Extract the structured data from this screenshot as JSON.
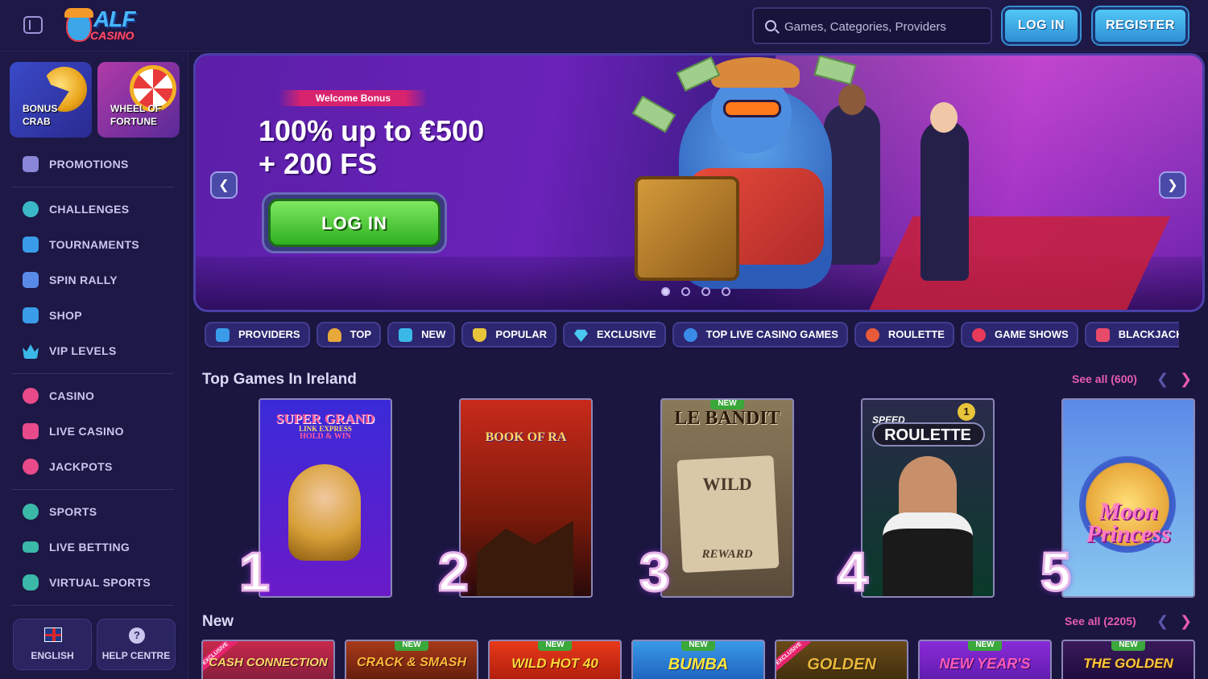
{
  "header": {
    "logo_line1": "ALF",
    "logo_line2": "CASINO",
    "search_placeholder": "Games, Categories, Providers",
    "login_label": "LOG IN",
    "register_label": "REGISTER"
  },
  "sidebar": {
    "promo_tiles": [
      {
        "label_line1": "BONUS",
        "label_line2": "CRAB"
      },
      {
        "label_line1": "WHEEL OF",
        "label_line2": "FORTUNE"
      }
    ],
    "items": [
      {
        "label": "PROMOTIONS",
        "icon": "gift-icon"
      },
      {
        "label": "CHALLENGES",
        "icon": "medal-icon"
      },
      {
        "label": "TOURNAMENTS",
        "icon": "podium-icon"
      },
      {
        "label": "SPIN RALLY",
        "icon": "flag-icon"
      },
      {
        "label": "SHOP",
        "icon": "shopping-bag-icon"
      },
      {
        "label": "VIP LEVELS",
        "icon": "crown-icon"
      },
      {
        "label": "CASINO",
        "icon": "cherry-icon"
      },
      {
        "label": "LIVE CASINO",
        "icon": "cards-icon"
      },
      {
        "label": "JACKPOTS",
        "icon": "clover-icon"
      },
      {
        "label": "SPORTS",
        "icon": "ball-icon"
      },
      {
        "label": "LIVE BETTING",
        "icon": "live-icon"
      },
      {
        "label": "VIRTUAL SPORTS",
        "icon": "gamepad-icon"
      }
    ],
    "language_label": "ENGLISH",
    "help_label": "HELP CENTRE",
    "help_glyph": "?"
  },
  "banner": {
    "tag": "Welcome Bonus",
    "headline_line1": "100% up to €500",
    "headline_line2": "+ 200 FS",
    "cta_label": "LOG IN",
    "prev_glyph": "❮",
    "next_glyph": "❯",
    "slide_count": 4,
    "active_slide": 1
  },
  "categories": [
    {
      "label": "PROVIDERS",
      "icon": "providers-icon",
      "color": "#3a9be8"
    },
    {
      "label": "TOP",
      "icon": "trophy-icon",
      "color": "#e8a83a"
    },
    {
      "label": "NEW",
      "icon": "sparkle-icon",
      "color": "#3ab8e8"
    },
    {
      "label": "POPULAR",
      "icon": "shield-icon",
      "color": "#e8c43a"
    },
    {
      "label": "EXCLUSIVE",
      "icon": "diamond-icon",
      "color": "#4ac8f0"
    },
    {
      "label": "TOP LIVE CASINO GAMES",
      "icon": "globe-icon",
      "color": "#3a8ae8"
    },
    {
      "label": "ROULETTE",
      "icon": "roulette-icon",
      "color": "#e85a3a"
    },
    {
      "label": "GAME SHOWS",
      "icon": "wheel-icon",
      "color": "#e83a5a"
    },
    {
      "label": "BLACKJACK",
      "icon": "cards-icon",
      "color": "#e84a6a"
    }
  ],
  "top_games": {
    "title": "Top Games In Ireland",
    "see_all": "See all (600)",
    "prev_glyph": "❮",
    "next_glyph": "❯",
    "games": [
      {
        "rank": "1",
        "title_line1": "SUPER GRAND",
        "title_line2": "LINK EXPRESS",
        "title_line3": "HOLD & WIN",
        "new": ""
      },
      {
        "rank": "2",
        "title_line1": "BOOK OF RA",
        "title_line2": "",
        "title_line3": "",
        "new": ""
      },
      {
        "rank": "3",
        "title_line1": "LE BANDIT",
        "title_line2": "WILD",
        "title_line3": "REWARD",
        "new": "NEW"
      },
      {
        "rank": "4",
        "title_line1": "SPEED",
        "title_line2": "ROULETTE",
        "title_line3": "1",
        "new": ""
      },
      {
        "rank": "5",
        "title_line1": "Moon",
        "title_line2": "Princess",
        "title_line3": "",
        "new": ""
      }
    ]
  },
  "new_games": {
    "title": "New",
    "see_all": "See all (2205)",
    "prev_glyph": "❮",
    "next_glyph": "❯",
    "games": [
      {
        "title": "CASH CONNECTION",
        "badge": "",
        "exclusive": "EXCLUSIVE"
      },
      {
        "title": "CRACK & SMASH",
        "badge": "NEW",
        "exclusive": ""
      },
      {
        "title": "WILD HOT 40",
        "badge": "NEW",
        "exclusive": ""
      },
      {
        "title": "BUMBA",
        "badge": "NEW",
        "exclusive": ""
      },
      {
        "title": "GOLDEN",
        "badge": "",
        "exclusive": "EXCLUSIVE"
      },
      {
        "title": "NEW YEAR'S",
        "badge": "NEW",
        "exclusive": ""
      },
      {
        "title": "THE GOLDEN",
        "badge": "NEW",
        "exclusive": ""
      }
    ]
  }
}
